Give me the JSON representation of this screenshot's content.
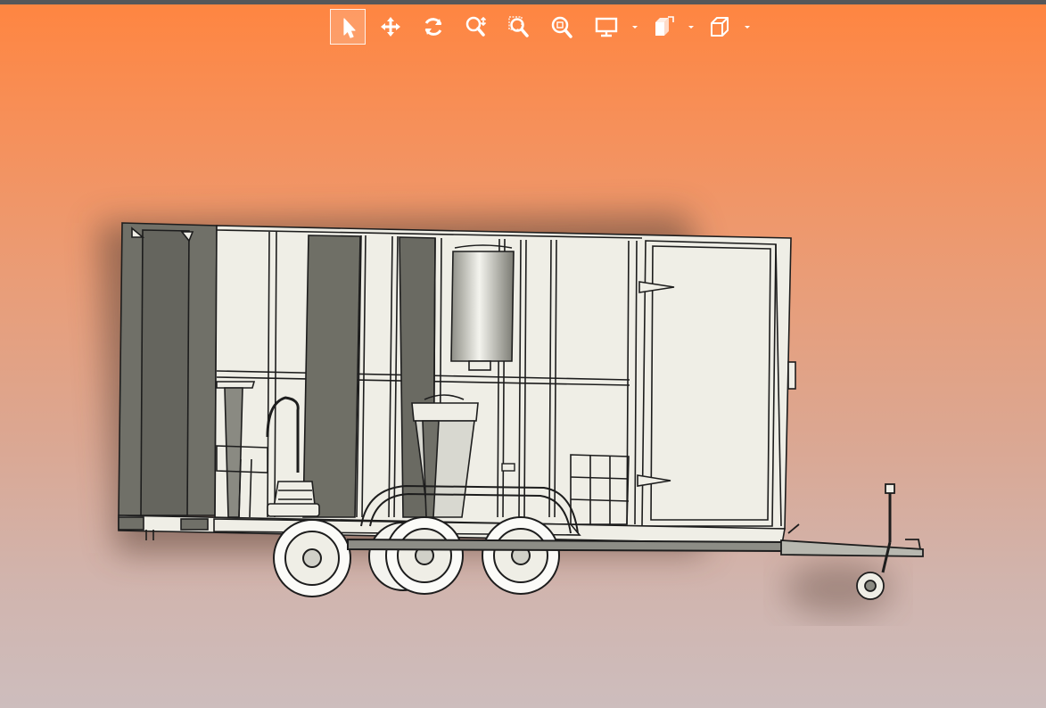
{
  "window": {
    "title": ""
  },
  "toolbar": {
    "tools": [
      {
        "name": "select",
        "icon": "cursor-arrow-icon",
        "active": true
      },
      {
        "name": "pan",
        "icon": "move-arrows-icon",
        "active": false
      },
      {
        "name": "rotate",
        "icon": "rotate-icon",
        "active": false
      },
      {
        "name": "zoom",
        "icon": "zoom-in-out-icon",
        "active": false
      },
      {
        "name": "zoom-window",
        "icon": "zoom-window-icon",
        "active": false
      },
      {
        "name": "zoom-fit",
        "icon": "zoom-fit-icon",
        "active": false
      },
      {
        "name": "display-style",
        "icon": "monitor-icon",
        "active": false,
        "has_dropdown": true
      },
      {
        "name": "view-orientation",
        "icon": "view-cube-icon",
        "active": false,
        "has_dropdown": true
      },
      {
        "name": "section-view",
        "icon": "wireframe-box-icon",
        "active": false,
        "has_dropdown": true
      }
    ]
  },
  "model": {
    "name": "trailer-3d-model",
    "colors": {
      "panel": "#efeee6",
      "dark_panel": "#6f6f66",
      "edge": "#1d1d1d",
      "background_top": "#ff8540",
      "background_bottom": "#cdbdbd"
    }
  }
}
